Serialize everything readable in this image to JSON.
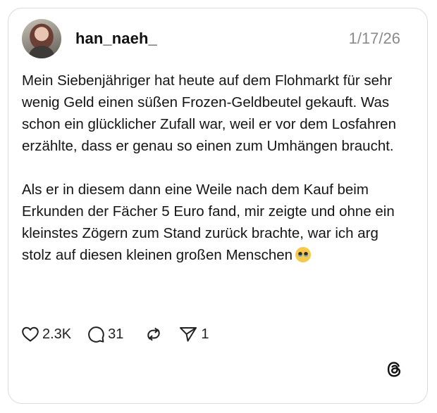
{
  "post": {
    "username": "han_naeh_",
    "date": "1/17/26",
    "paragraphs": [
      "Mein Siebenjähriger hat heute auf dem Flohmarkt für sehr wenig Geld einen süßen Frozen-Geldbeutel gekauft. Was schon ein glücklicher Zufall war, weil er vor dem Losfahren erzählte, dass er genau so einen zum Umhängen braucht.",
      "Als er in diesem dann eine Weile nach dem Kauf beim Erkunden der Fächer 5 Euro fand, mir zeigte und ohne ein kleinstes Zögern zum Stand zurück brachte, war ich arg stolz auf diesen kleinen großen Menschen"
    ],
    "emoji": "pleading-face-emoji",
    "likes": "2.3K",
    "replies": "31",
    "shares": "1"
  },
  "icons": {
    "like": "heart-icon",
    "reply": "speech-bubble-icon",
    "repost": "repost-icon",
    "share": "send-icon",
    "brand": "threads-logo-icon"
  },
  "colors": {
    "text": "#151515",
    "muted": "#8a8a8a",
    "border": "#dcdcdc",
    "background": "#ffffff"
  }
}
